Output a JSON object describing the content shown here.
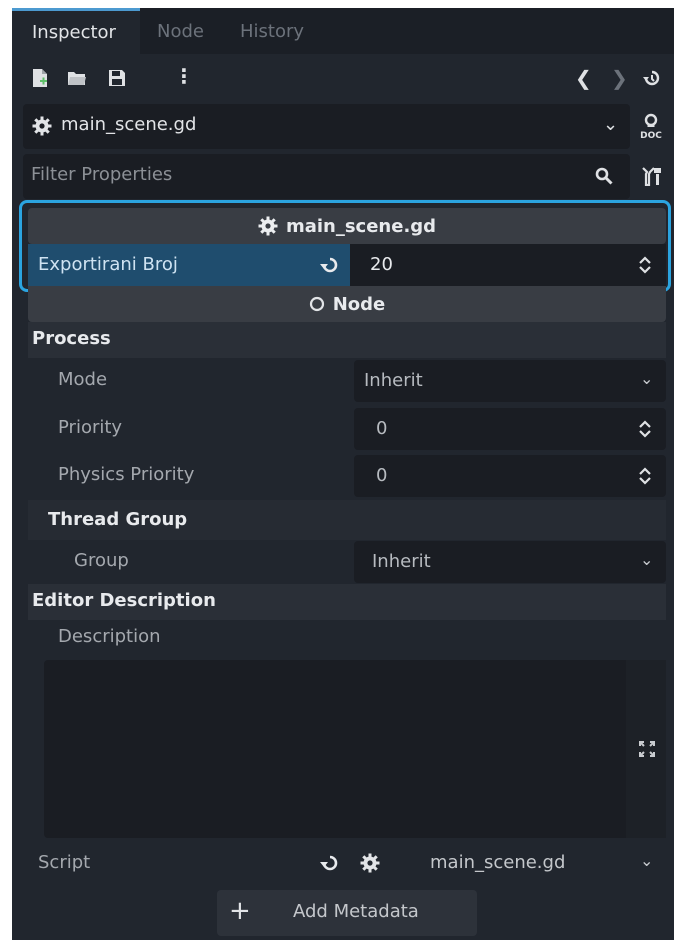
{
  "tabs": [
    "Inspector",
    "Node",
    "History"
  ],
  "resource": {
    "name": "main_scene.gd"
  },
  "filter": {
    "placeholder": "Filter Properties"
  },
  "script_section": {
    "title": "main_scene.gd",
    "property_label": "Exportirani Broj",
    "property_value": "20"
  },
  "node_section": {
    "title": "Node"
  },
  "process": {
    "title": "Process",
    "rows": [
      {
        "label": "Mode",
        "value": "Inherit"
      },
      {
        "label": "Priority",
        "value": "0"
      },
      {
        "label": "Physics Priority",
        "value": "0"
      }
    ],
    "thread_group": {
      "title": "Thread Group",
      "label": "Group",
      "value": "Inherit"
    }
  },
  "editor_description": {
    "title": "Editor Description",
    "label": "Description",
    "value": ""
  },
  "script_row": {
    "label": "Script",
    "value": "main_scene.gd"
  },
  "add_metadata": {
    "label": "Add Metadata"
  },
  "colors": {
    "accent": "#4c9ad0",
    "selection": "#1f4d6e",
    "panel": "#21262e"
  }
}
